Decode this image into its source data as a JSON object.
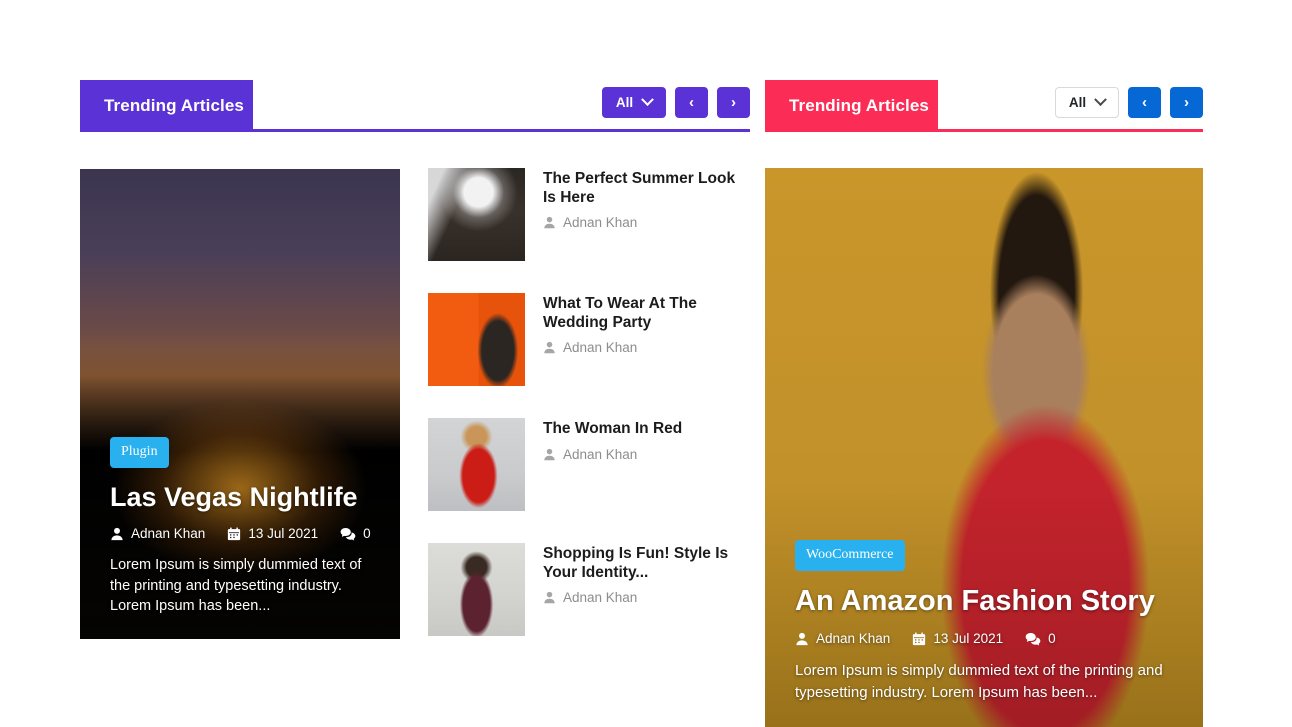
{
  "widgets": [
    {
      "id": "left",
      "title": "Trending Articles",
      "accent": "#5b32d6",
      "controls": {
        "select_label": "All",
        "prev_label": "‹",
        "next_label": "›"
      },
      "featured": {
        "badge": "Plugin",
        "title": "Las Vegas Nightlife",
        "author": "Adnan Khan",
        "date": "13 Jul 2021",
        "comments": "0",
        "excerpt": "Lorem Ipsum is simply dummied text of the printing and typesetting industry. Lorem Ipsum has been..."
      },
      "articles": [
        {
          "title": "The Perfect Summer Look Is Here",
          "author": "Adnan Khan"
        },
        {
          "title": "What To Wear At The Wedding Party",
          "author": "Adnan Khan"
        },
        {
          "title": "The Woman In Red",
          "author": "Adnan Khan"
        },
        {
          "title": "Shopping Is Fun! Style Is Your Identity...",
          "author": "Adnan Khan"
        }
      ]
    },
    {
      "id": "right",
      "title": "Trending Articles",
      "accent": "#fb2c56",
      "controls": {
        "select_label": "All",
        "prev_label": "‹",
        "next_label": "›"
      },
      "featured": {
        "badge": "WooCommerce",
        "title": "An Amazon Fashion Story",
        "author": "Adnan Khan",
        "date": "13 Jul 2021",
        "comments": "0",
        "excerpt": "Lorem Ipsum is simply dummied text of the printing and typesetting industry. Lorem Ipsum has been..."
      }
    }
  ],
  "icons": {
    "user": "user-icon",
    "calendar": "calendar-icon",
    "comment": "comment-icon",
    "chevron_down": "chevron-down-icon",
    "chevron_left": "chevron-left-icon",
    "chevron_right": "chevron-right-icon"
  },
  "colors": {
    "purple": "#5b32d6",
    "pink": "#fb2c56",
    "blue_button": "#0568d4",
    "badge_blue": "#29b1ef",
    "title_dark": "#1c1c1c",
    "author_gray": "#8d8d8d"
  }
}
